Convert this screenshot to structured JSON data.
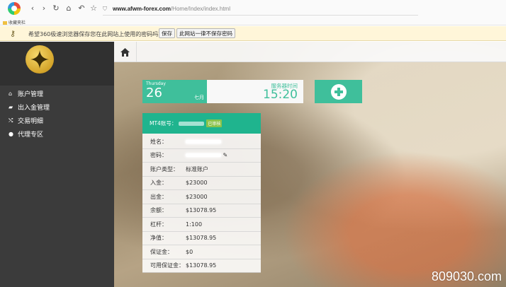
{
  "browser": {
    "url_host": "www.afwm-forex.com",
    "url_path": "/Home/Index/index.html",
    "bookmarks_label": "收藏夹栏"
  },
  "password_bar": {
    "message": "希望360极速浏览器保存您在此网站上使用的密码吗？",
    "save_label": "保存",
    "never_label": "此网站一律不保存密码"
  },
  "sidebar": {
    "items": [
      {
        "label": "账户管理",
        "icon": "home-icon"
      },
      {
        "label": "出入金管理",
        "icon": "folder-icon"
      },
      {
        "label": "交易明细",
        "icon": "shuffle-icon"
      },
      {
        "label": "代理专区",
        "icon": "user-icon"
      }
    ]
  },
  "date_widget": {
    "weekday": "Thursday",
    "day": "26",
    "month": "七月"
  },
  "server_time": {
    "label": "服务器时间",
    "time": "15:20"
  },
  "account_card": {
    "title": "MT4账号：",
    "badge": "已审核",
    "rows": [
      {
        "label": "姓名：",
        "value": ""
      },
      {
        "label": "密码：",
        "value": ""
      },
      {
        "label": "账户类型：",
        "value": "标准账户"
      },
      {
        "label": "入金：",
        "value": "$23000"
      },
      {
        "label": "出金：",
        "value": "$23000"
      },
      {
        "label": "余额：",
        "value": "$13078.95"
      },
      {
        "label": "杠杆：",
        "value": "1:100"
      },
      {
        "label": "净值：",
        "value": "$13078.95"
      },
      {
        "label": "保证金：",
        "value": "$0"
      },
      {
        "label": "可用保证金：",
        "value": "$13078.95"
      }
    ]
  },
  "watermark": "809030.com",
  "colors": {
    "accent": "#3fbf9b",
    "sidebar": "#3b3b3b"
  }
}
